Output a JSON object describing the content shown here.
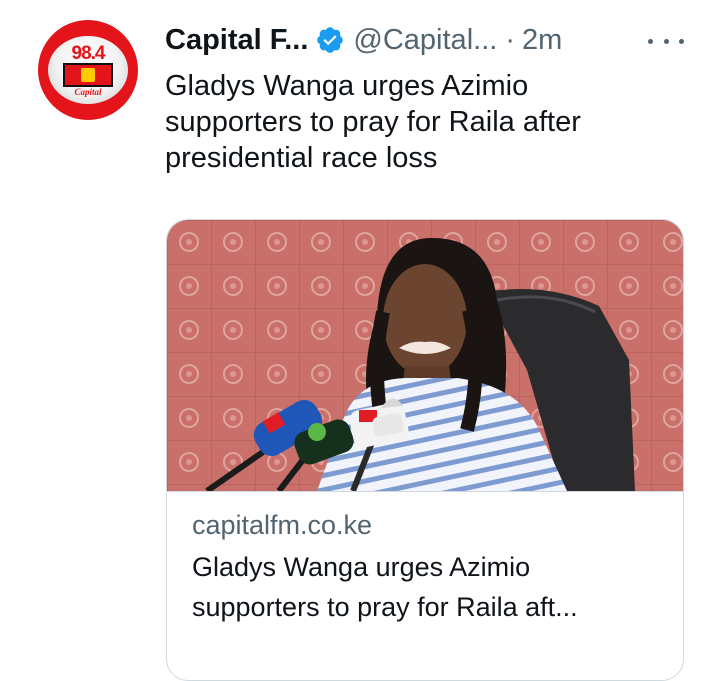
{
  "tweet": {
    "author_name": "Capital F...",
    "handle": "@Capital...",
    "separator": "·",
    "time": "2m",
    "text": "Gladys Wanga urges Azimio supporters to pray for Raila after presidential race loss",
    "avatar": {
      "logo_number": "98.4",
      "logo_word": "Capital",
      "icon": "capital-fm-logo"
    },
    "verified_icon": "verified-badge-icon",
    "verified_color": "#1d9bf0",
    "more_icon": "more-options-icon"
  },
  "card": {
    "domain": "capitalfm.co.ke",
    "title_line1": "Gladys Wanga urges Azimio",
    "title_line2": "supporters to pray for Raila aft...",
    "image_icon": "press-conference-photo"
  },
  "colors": {
    "text_primary": "#0f1419",
    "text_secondary": "#536471",
    "border": "#cfd9de",
    "brand_red": "#e3151b"
  }
}
